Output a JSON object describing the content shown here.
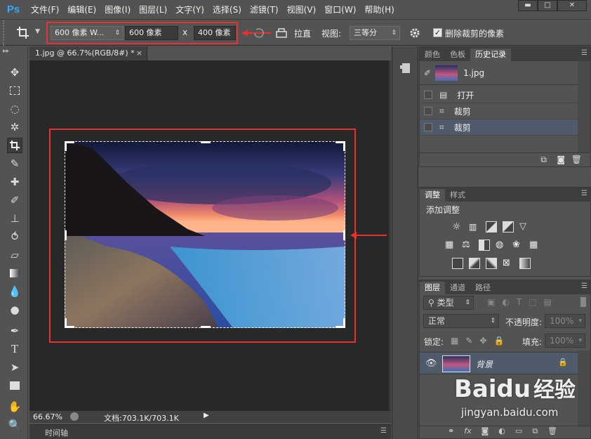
{
  "app": {
    "logo": "Ps"
  },
  "menu": [
    "文件(F)",
    "编辑(E)",
    "图像(I)",
    "图层(L)",
    "文字(Y)",
    "选择(S)",
    "滤镜(T)",
    "视图(V)",
    "窗口(W)",
    "帮助(H)"
  ],
  "window_controls": {
    "minimize": "▬",
    "maximize": "□",
    "close": "✕"
  },
  "options": {
    "preset_value": "600 像素 W...",
    "width_value": "600 像素",
    "times": "x",
    "height_value": "400 像素",
    "straighten_label": "拉直",
    "view_label": "视图:",
    "view_value": "三等分",
    "delete_pixels_label": "删除裁剪的像素"
  },
  "document": {
    "tab_title": "1.jpg @ 66.7%(RGB/8#) *",
    "tab_close": "×",
    "zoom": "66.67%",
    "doc_info": "文档:703.1K/703.1K",
    "timeline_label": "时间轴"
  },
  "history_panel": {
    "tabs": [
      "颜色",
      "色板",
      "历史记录"
    ],
    "active_tab": "历史记录",
    "snapshot_name": "1.jpg",
    "items": [
      "打开",
      "裁剪",
      "裁剪"
    ]
  },
  "adjustments_panel": {
    "tabs": [
      "调整",
      "样式"
    ],
    "active_tab": "调整",
    "title": "添加调整"
  },
  "layers_panel": {
    "tabs": [
      "图层",
      "通道",
      "路径"
    ],
    "active_tab": "图层",
    "filter_label": "类型",
    "blend_mode": "正常",
    "opacity_label": "不透明度:",
    "opacity_value": "100%",
    "lock_label": "锁定:",
    "fill_label": "填充:",
    "fill_value": "100%",
    "layer_name": "背景"
  },
  "watermark": {
    "brand": "Baidu",
    "brand_cn": "经验",
    "url": "jingyan.baidu.com"
  },
  "colors": {
    "accent_red": "#e8302f",
    "ps_blue": "#31a8ff",
    "selected_row": "#4f5b6b"
  }
}
